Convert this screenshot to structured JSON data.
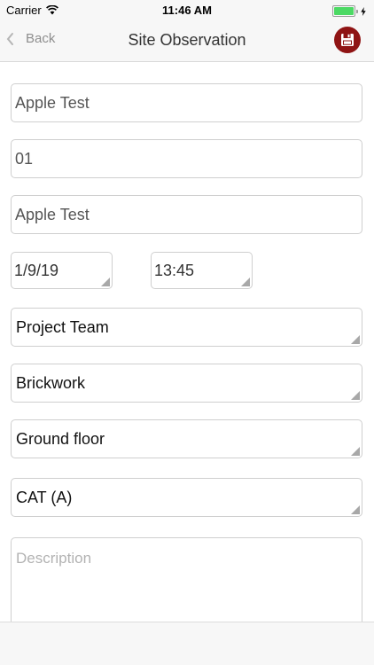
{
  "status_bar": {
    "carrier": "Carrier",
    "time": "11:46 AM",
    "battery_level": 1.0,
    "battery_color": "#4cd964"
  },
  "nav": {
    "back_label": "Back",
    "title": "Site Observation",
    "save_icon": "floppy-disk-icon",
    "save_color": "#8f1414"
  },
  "form": {
    "project_name": "Apple Test",
    "number": "01",
    "name": "Apple Test",
    "date": "1/9/19",
    "time": "13:45",
    "observer": "Project Team",
    "trade": "Brickwork",
    "location": "Ground floor",
    "category": "CAT (A)",
    "description_placeholder": "Description",
    "description_value": ""
  }
}
